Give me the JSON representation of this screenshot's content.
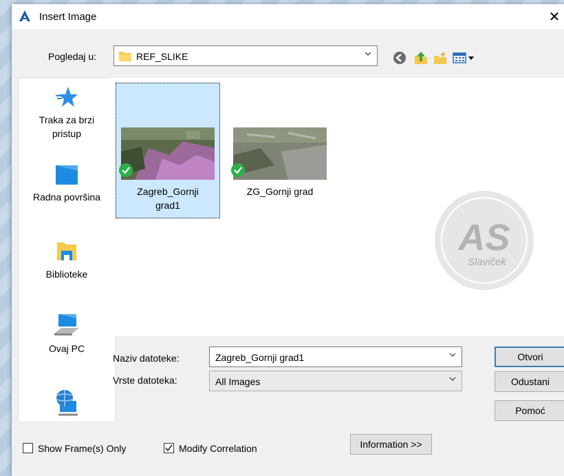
{
  "window": {
    "title": "Insert Image",
    "close_symbol": "✕"
  },
  "look_in": {
    "label": "Pogledaj u:",
    "value": "REF_SLIKE"
  },
  "toolbar": {
    "icons": [
      "back-icon",
      "up-folder-icon",
      "new-folder-icon",
      "view-menu-icon"
    ]
  },
  "places": [
    {
      "label_line1": "Traka za brzi",
      "label_line2": "pristup",
      "icon": "quick-access-star-icon"
    },
    {
      "label_line1": "Radna površina",
      "label_line2": "",
      "icon": "desktop-icon"
    },
    {
      "label_line1": "Biblioteke",
      "label_line2": "",
      "icon": "libraries-icon"
    },
    {
      "label_line1": "Ovaj PC",
      "label_line2": "",
      "icon": "this-pc-icon"
    },
    {
      "label_line1": "",
      "label_line2": "",
      "icon": "network-icon"
    }
  ],
  "files": [
    {
      "name_line1": "Zagreb_Gornji",
      "name_line2": "grad1",
      "selected": true,
      "status": "check-icon"
    },
    {
      "name_line1": "ZG_Gornji grad",
      "name_line2": "",
      "selected": false,
      "status": "check-icon"
    }
  ],
  "watermark": {
    "big": "AS",
    "small": "Slaviček"
  },
  "filename": {
    "label": "Naziv datoteke:",
    "value": "Zagreb_Gornji grad1"
  },
  "filetype": {
    "label": "Vrste datoteka:",
    "value": "All Images"
  },
  "buttons": {
    "open": "Otvori",
    "cancel": "Odustani",
    "help": "Pomoć",
    "information": "Information >>"
  },
  "options": {
    "show_frames": {
      "label": "Show Frame(s) Only",
      "checked": false
    },
    "modify_correlation": {
      "label": "Modify Correlation",
      "checked": true
    }
  },
  "colors": {
    "selection": "#cce8ff",
    "default_button_border": "#3c7fb1",
    "check_green": "#2fae49"
  }
}
